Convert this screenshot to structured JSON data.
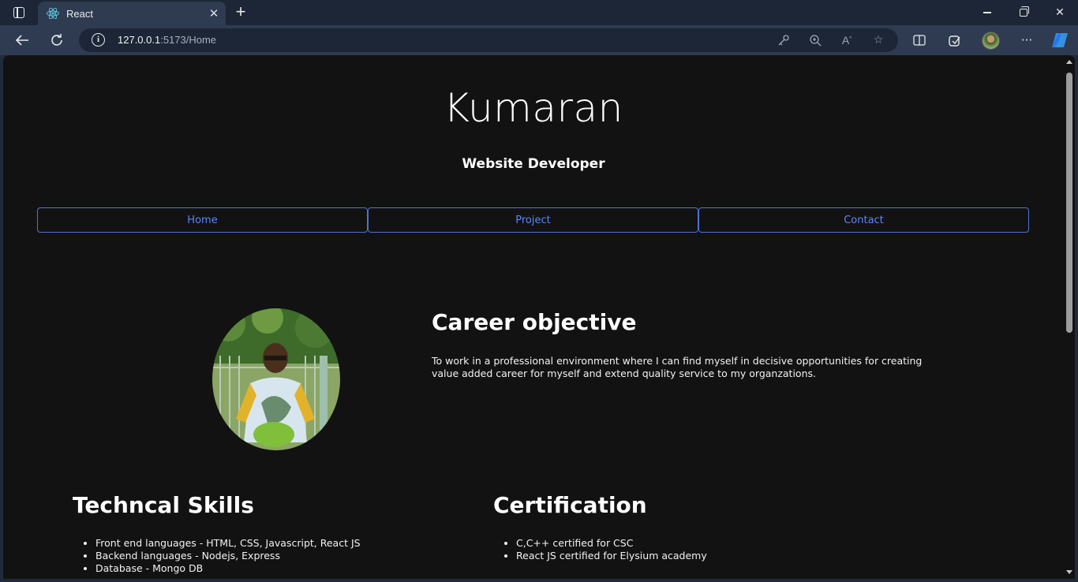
{
  "browser": {
    "tab_title": "React",
    "url_host": "127.0.0.1",
    "url_rest": ":5173/Home"
  },
  "page": {
    "name": "Kumaran",
    "role": "Website Developer",
    "nav": [
      {
        "label": "Home"
      },
      {
        "label": "Project"
      },
      {
        "label": "Contact"
      }
    ],
    "career": {
      "title": "Career objective",
      "text": "To work in a professional environment where I can find myself in decisive opportunities for creating value added career for myself and extend quality service to my organzations."
    },
    "skills": {
      "title": "Techncal Skills",
      "items": [
        "Front end languages - HTML, CSS, Javascript, React JS",
        "Backend languages - Nodejs, Express",
        "Database - Mongo DB"
      ]
    },
    "certification": {
      "title": "Certification",
      "items": [
        "C,C++ certified for CSC",
        "React JS certified for Elysium academy"
      ]
    }
  },
  "colors": {
    "page_bg": "#121212",
    "nav_border": "#4f73d6",
    "nav_text": "#5a86ff",
    "chrome_bg": "#2f3b50"
  },
  "icons": [
    "sidebar-toggle-icon",
    "react-logo-icon",
    "close-icon",
    "plus-icon",
    "back-arrow-icon",
    "reload-icon",
    "info-icon",
    "key-icon",
    "zoom-icon",
    "read-aloud-icon",
    "star-icon",
    "split-screen-icon",
    "extensions-icon",
    "more-icon",
    "copilot-icon"
  ]
}
